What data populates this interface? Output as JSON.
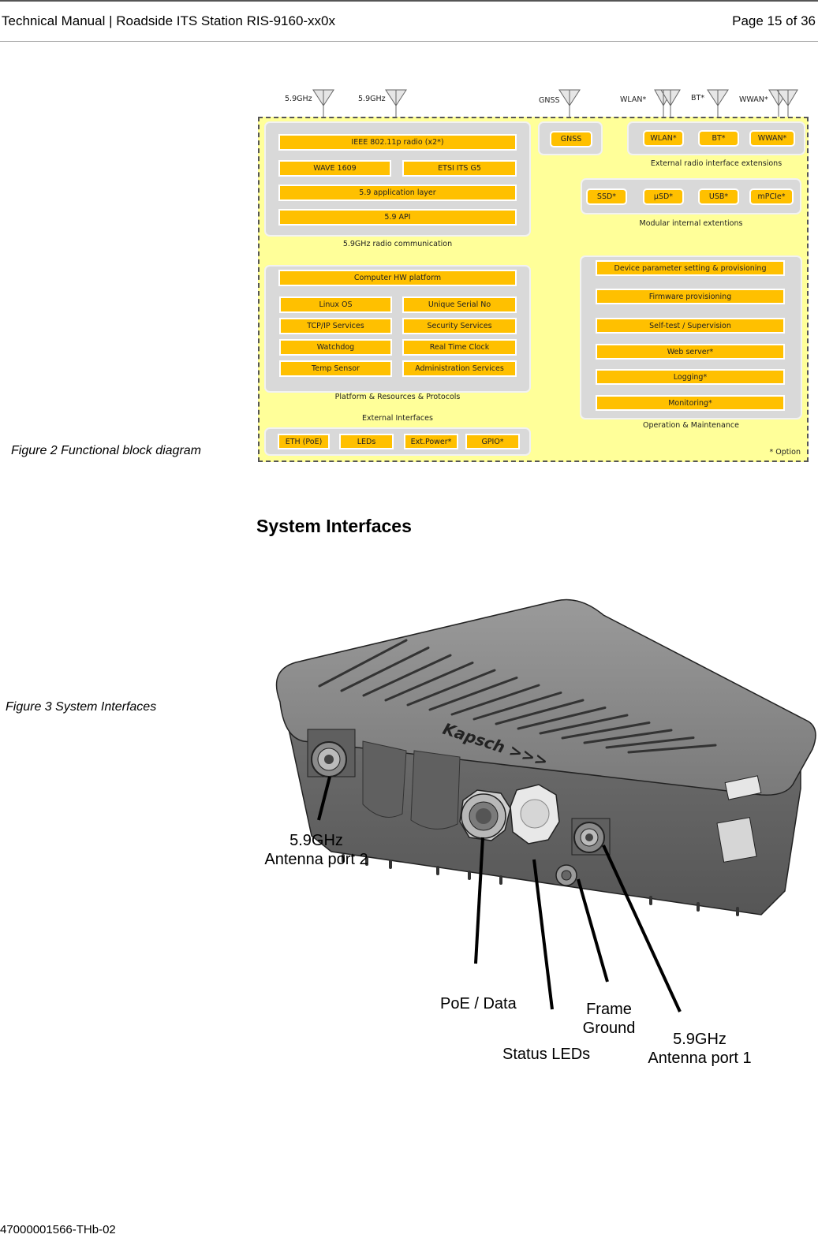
{
  "header": {
    "title": "Technical Manual | Roadside ITS Station RIS-9160-xx0x",
    "page": "Page 15 of 36"
  },
  "figure2": {
    "caption": "Figure 2 Functional block diagram",
    "antennas": [
      "5.9GHz",
      "5.9GHz",
      "GNSS",
      "WLAN*",
      "BT*",
      "WWAN*"
    ],
    "radio_comm": {
      "label": "5.9GHz radio communication",
      "blocks": [
        "IEEE 802.11p radio (x2*)",
        "WAVE 1609",
        "ETSI ITS G5",
        "5.9 application layer",
        "5.9 API"
      ]
    },
    "gnss": {
      "blocks": [
        "GNSS"
      ]
    },
    "ext_radio": {
      "label": "External radio interface extensions",
      "blocks": [
        "WLAN*",
        "BT*",
        "WWAN*"
      ]
    },
    "modular": {
      "label": "Modular internal extentions",
      "blocks": [
        "SSD*",
        "µSD*",
        "USB*",
        "mPCIe*"
      ]
    },
    "platform": {
      "label": "Platform & Resources & Protocols",
      "header_block": "Computer HW platform",
      "left": [
        "Linux OS",
        "TCP/IP Services",
        "Watchdog",
        "Temp Sensor"
      ],
      "right": [
        "Unique Serial No",
        "Security Services",
        "Real Time Clock",
        "Administration Services"
      ]
    },
    "external": {
      "label": "External Interfaces",
      "blocks": [
        "ETH (PoE)",
        "LEDs",
        "Ext.Power*",
        "GPIO*"
      ]
    },
    "operation": {
      "label": "Operation & Maintenance",
      "blocks": [
        "Device parameter setting & provisioning",
        "Firmware provisioning",
        "Self-test / Supervision",
        "Web server*",
        "Logging*",
        "Monitoring*"
      ]
    },
    "legend": "* Option",
    "colors": {
      "background": "#ffff99",
      "panel": "#d9d9d9",
      "block": "#ffc000"
    }
  },
  "section": {
    "title": "System Interfaces"
  },
  "figure3": {
    "caption": "Figure 3 System Interfaces",
    "brand": "Kapsch >>>",
    "callouts": {
      "antenna2": [
        "5.9GHz",
        "Antenna port 2"
      ],
      "poe": "PoE / Data",
      "leds": "Status LEDs",
      "ground": [
        "Frame",
        "Ground"
      ],
      "antenna1": [
        "5.9GHz",
        "Antenna port 1"
      ]
    }
  },
  "footer": {
    "doc_id": "47000001566-THb-02"
  }
}
